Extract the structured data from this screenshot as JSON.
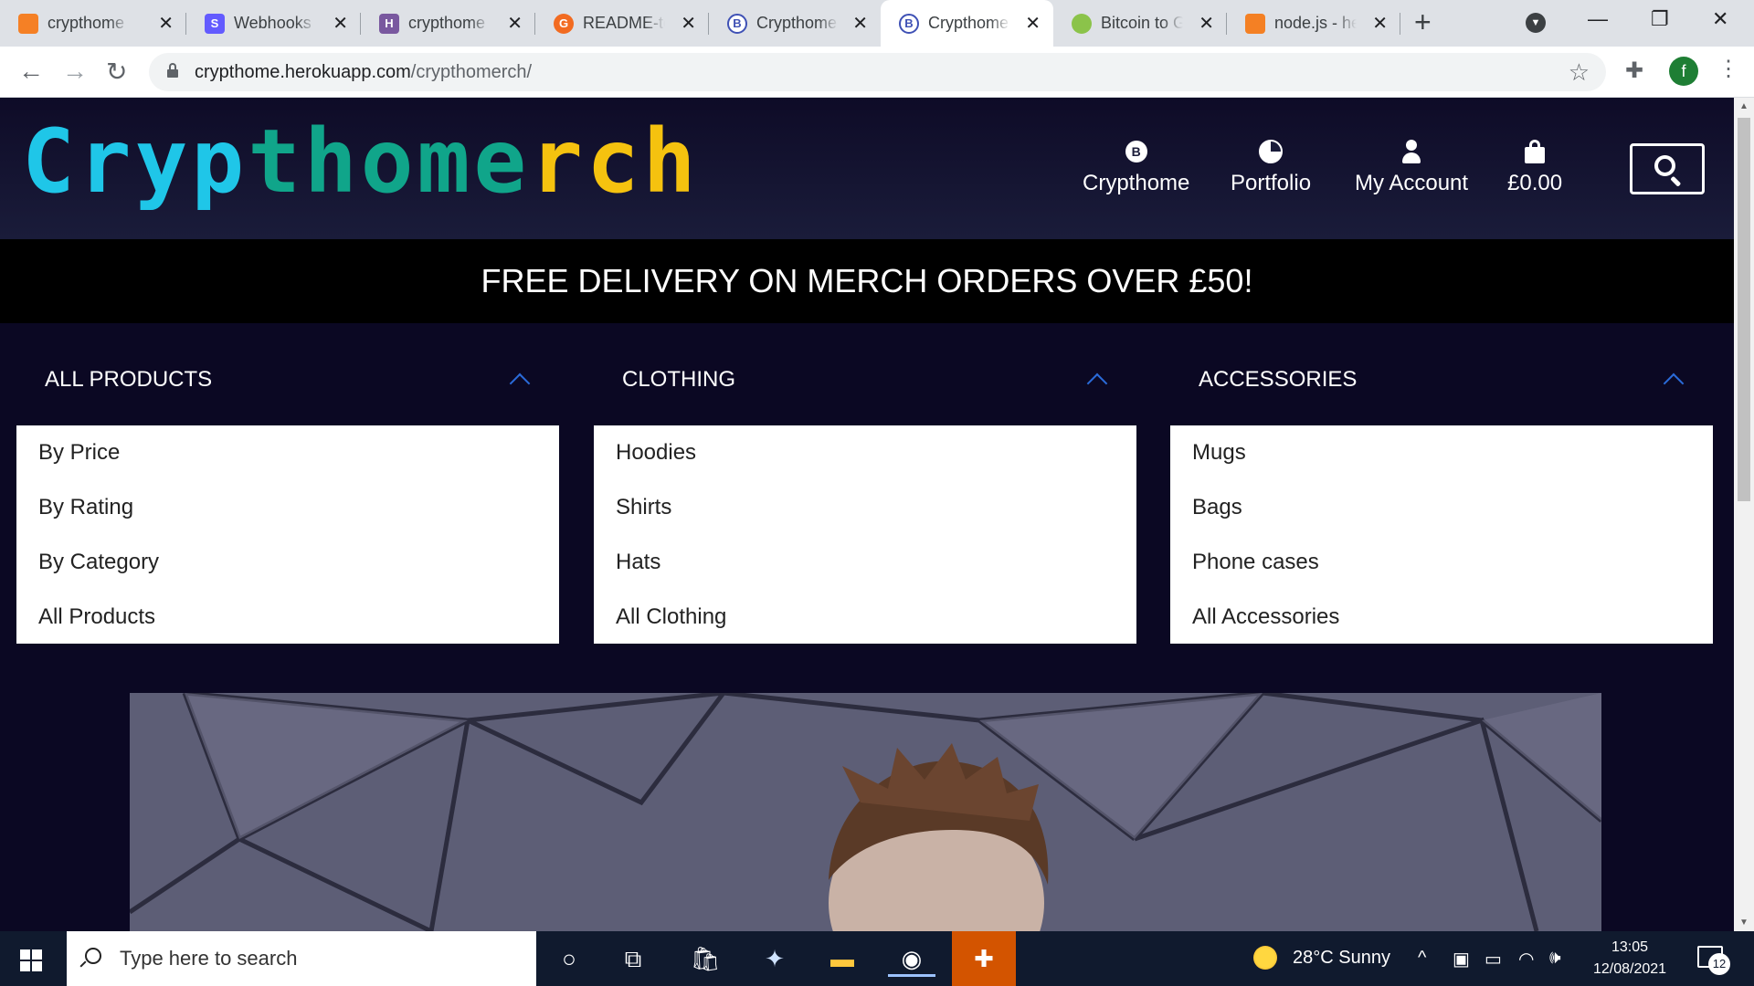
{
  "browser": {
    "tabs": [
      {
        "title": "crypthome",
        "favicon_color": "#f58025"
      },
      {
        "title": "Webhooks -",
        "favicon_color": "#635bff"
      },
      {
        "title": "crypthome",
        "favicon_color": "#79589f"
      },
      {
        "title": "README-te",
        "favicon_color": "#f26b21"
      },
      {
        "title": "Crypthome",
        "favicon_color": "#3f51b5"
      },
      {
        "title": "Crypthome",
        "favicon_color": "#3f51b5",
        "active": true
      },
      {
        "title": "Bitcoin to G",
        "favicon_color": "#8bc34a"
      },
      {
        "title": "node.js - he",
        "favicon_color": "#f48024"
      }
    ],
    "new_tab_label": "+",
    "url_host": "crypthome.herokuapp.com",
    "url_path": "/crypthomerch/",
    "profile_initial": "f"
  },
  "site": {
    "logo": {
      "part1": "Cryp",
      "part2": "thome",
      "part3": "rch"
    },
    "nav": [
      {
        "label": "Crypthome",
        "icon": "bitcoin-icon"
      },
      {
        "label": "Portfolio",
        "icon": "pie-chart-icon"
      },
      {
        "label": "My Account",
        "icon": "user-icon"
      },
      {
        "label": "£0.00",
        "icon": "shopping-bag-icon"
      }
    ],
    "banner": "FREE DELIVERY ON MERCH ORDERS OVER £50!",
    "menus": [
      {
        "title": "ALL PRODUCTS",
        "items": [
          "By Price",
          "By Rating",
          "By Category",
          "All Products"
        ]
      },
      {
        "title": "CLOTHING",
        "items": [
          "Hoodies",
          "Shirts",
          "Hats",
          "All Clothing"
        ]
      },
      {
        "title": "ACCESSORIES",
        "items": [
          "Mugs",
          "Bags",
          "Phone cases",
          "All Accessories"
        ]
      }
    ],
    "colors": {
      "logo_cyan": "#1fc6e8",
      "logo_green": "#10a58a",
      "logo_yellow": "#f5c20f",
      "accent_chevron": "#2a6bd9"
    }
  },
  "taskbar": {
    "search_placeholder": "Type here to search",
    "weather": "28°C  Sunny",
    "time": "13:05",
    "date": "12/08/2021",
    "notification_count": "12"
  }
}
